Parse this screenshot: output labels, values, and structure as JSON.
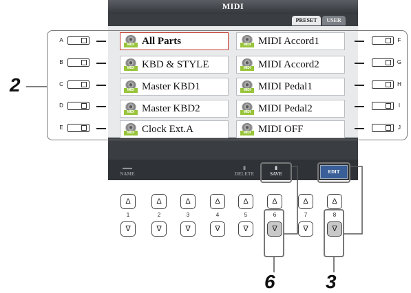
{
  "screen": {
    "title": "MIDI",
    "tabs": [
      {
        "label": "PRESET",
        "active": true
      },
      {
        "label": "USER",
        "active": false
      }
    ],
    "files_left": [
      {
        "label": "All Parts",
        "selected": true
      },
      {
        "label": "KBD & STYLE",
        "selected": false
      },
      {
        "label": "Master KBD1",
        "selected": false
      },
      {
        "label": "Master KBD2",
        "selected": false
      },
      {
        "label": "Clock Ext.A",
        "selected": false
      }
    ],
    "files_right": [
      {
        "label": "MIDI Accord1"
      },
      {
        "label": "MIDI Accord2"
      },
      {
        "label": "MIDI Pedal1"
      },
      {
        "label": "MIDI Pedal2"
      },
      {
        "label": "MIDI OFF"
      }
    ],
    "icon_label": "MIDI",
    "softkeys": [
      "NAME",
      "DELETE",
      "SAVE",
      "EDIT"
    ]
  },
  "side_buttons_left": [
    "A",
    "B",
    "C",
    "D",
    "E"
  ],
  "side_buttons_right": [
    "F",
    "G",
    "H",
    "I",
    "J"
  ],
  "number_buttons": [
    "1",
    "2",
    "3",
    "4",
    "5",
    "6",
    "7",
    "8"
  ],
  "up_glyph": "Δ",
  "down_glyph": "∇",
  "callouts": {
    "left": "2",
    "bottom_a": "6",
    "bottom_b": "3"
  },
  "colors": {
    "accent_edit": "#3a5f98",
    "icon_green": "#98c43a",
    "selection": "#c0392b"
  }
}
